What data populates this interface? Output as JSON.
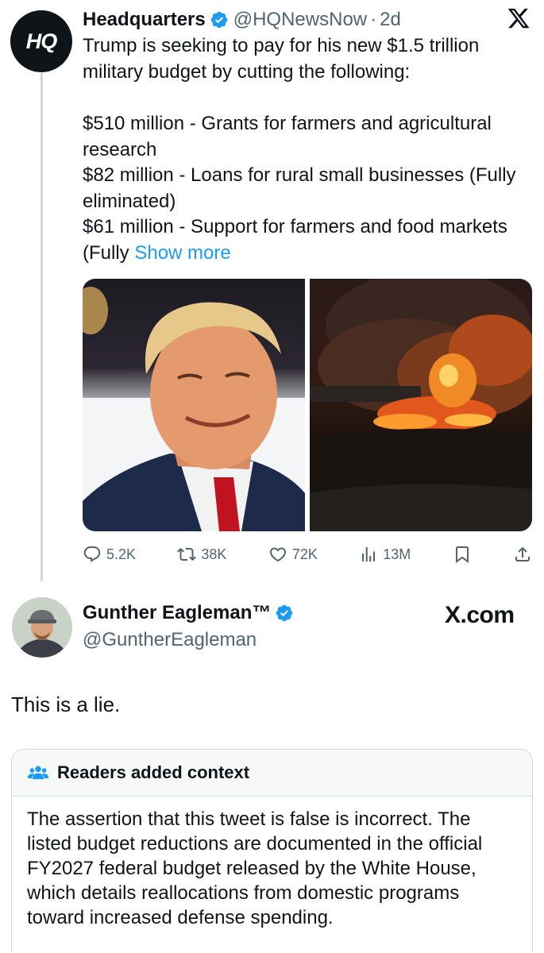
{
  "original_tweet": {
    "avatar_text": "HQ",
    "name": "Headquarters",
    "handle": "@HQNewsNow",
    "separator": "·",
    "time": "2d",
    "text_line1": "Trump is seeking to pay for his new $1.5 trillion military budget by cutting the following:",
    "text_line2": "$510 million - Grants for farmers and agricultural research",
    "text_line3": "$82 million - Loans for rural small businesses (Fully eliminated)",
    "text_line4": "$61 million - Support for farmers and food markets (Fully ",
    "show_more": "Show more",
    "stats": {
      "replies": "5.2K",
      "reposts": "38K",
      "likes": "72K",
      "views": "13M"
    }
  },
  "reply_tweet": {
    "name": "Gunther Eagleman™",
    "handle": "@GuntherEagleman",
    "brand": "X.com",
    "text": "This is a lie."
  },
  "community_note": {
    "title": "Readers added context",
    "text": "The assertion that this tweet is false is incorrect. The listed budget reductions are documented in the official FY2027 federal budget released by the White House, which details reallocations from domestic programs toward increased defense spending."
  },
  "colors": {
    "verified": "#1d9bf0",
    "link": "#1d9bf0",
    "secondary_text": "#536471",
    "note_header_bg": "#f7f9f9"
  },
  "icons": [
    "verified-badge-icon",
    "x-logo-icon",
    "reply-icon",
    "repost-icon",
    "like-icon",
    "views-icon",
    "bookmark-icon",
    "share-icon",
    "readers-people-icon"
  ]
}
